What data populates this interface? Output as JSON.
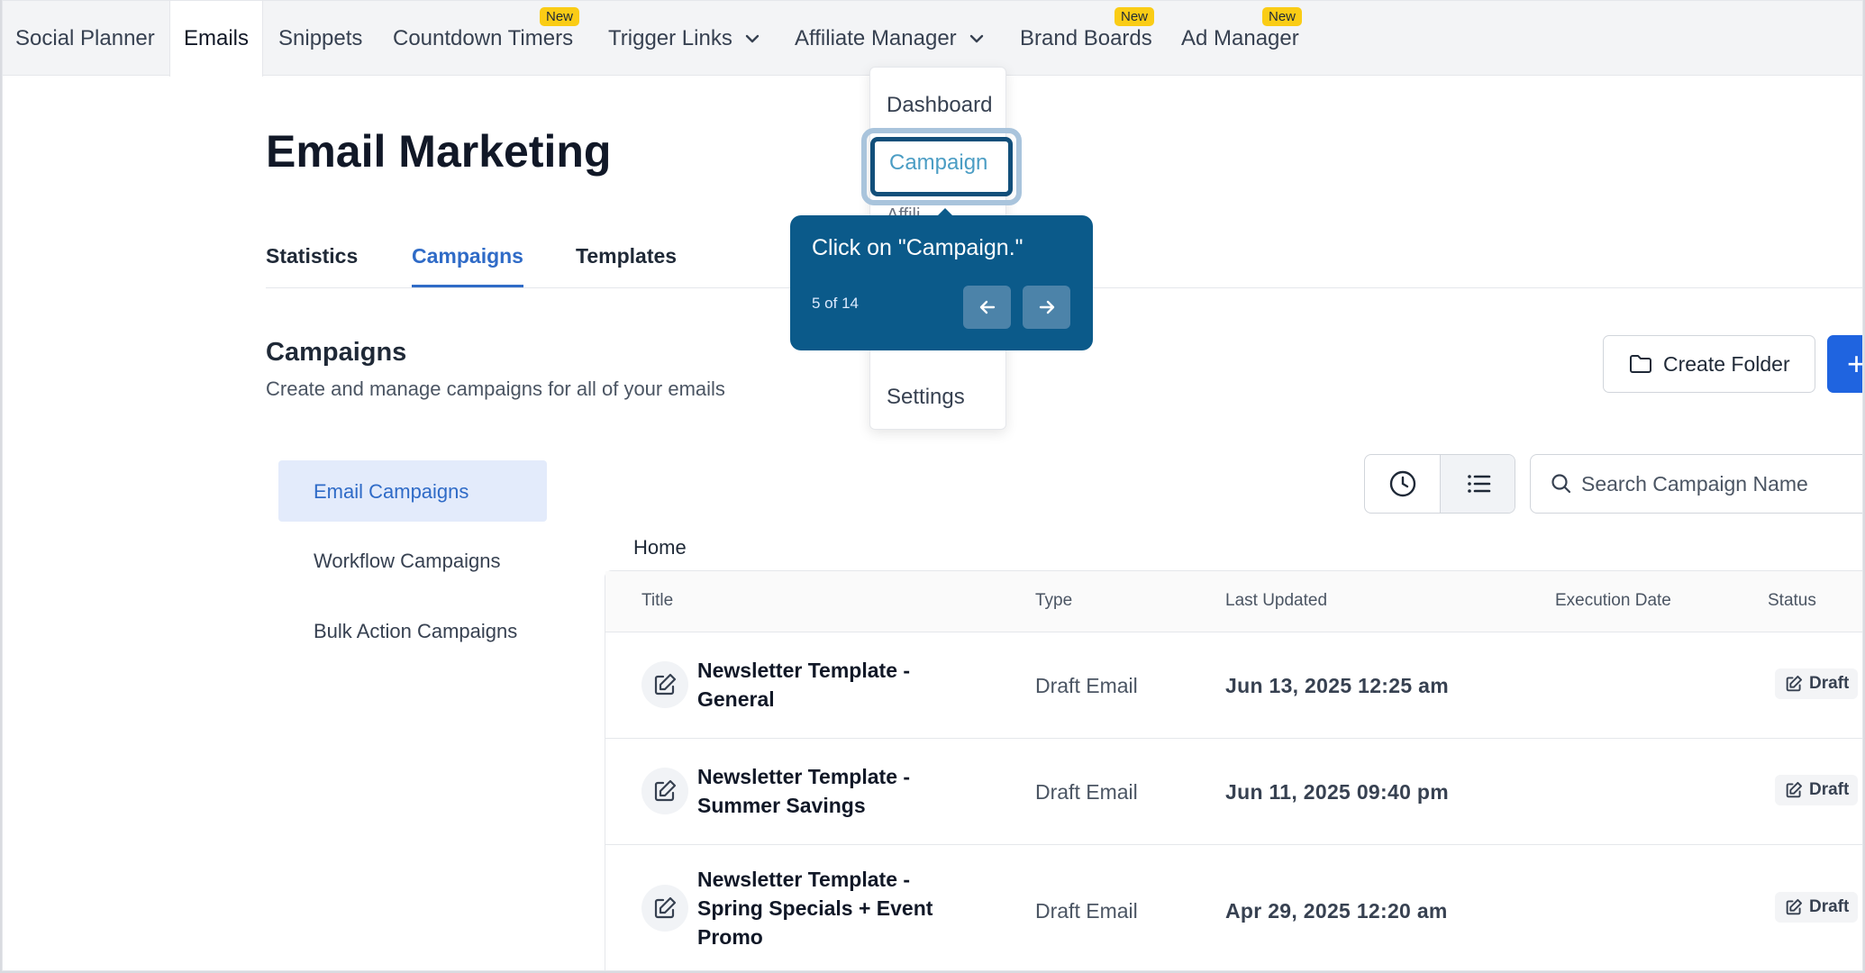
{
  "topnav": {
    "items": [
      {
        "label": "Social Planner"
      },
      {
        "label": "Emails"
      },
      {
        "label": "Snippets"
      },
      {
        "label": "Countdown Timers",
        "badge": "New"
      },
      {
        "label": "Trigger Links"
      },
      {
        "label": "Affiliate Manager"
      },
      {
        "label": "Brand Boards",
        "badge": "New"
      },
      {
        "label": "Ad Manager",
        "badge": "New"
      }
    ]
  },
  "dropdown": {
    "items": [
      "Dashboard",
      "Campaign",
      "Affili",
      "Settings"
    ]
  },
  "tooltip": {
    "text": "Click on \"Campaign.\"",
    "step": "5 of 14"
  },
  "page": {
    "title": "Email Marketing",
    "tabs": [
      "Statistics",
      "Campaigns",
      "Templates"
    ],
    "section_title": "Campaigns",
    "section_subtitle": "Create and manage campaigns for all of your emails",
    "create_folder_label": "Create Folder",
    "new_label": "+"
  },
  "sidebar": {
    "items": [
      "Email Campaigns",
      "Workflow Campaigns",
      "Bulk Action Campaigns"
    ]
  },
  "search": {
    "placeholder": "Search Campaign Name"
  },
  "breadcrumb": "Home",
  "table": {
    "headers": [
      "Title",
      "Type",
      "Last Updated",
      "Execution Date",
      "Status"
    ],
    "rows": [
      {
        "title": "Newsletter Template - General",
        "type": "Draft Email",
        "updated": "Jun 13, 2025 12:25 am",
        "status": "Draft"
      },
      {
        "title": "Newsletter Template - Summer Savings",
        "type": "Draft Email",
        "updated": "Jun 11, 2025 09:40 pm",
        "status": "Draft"
      },
      {
        "title": "Newsletter Template - Spring Specials + Event Promo",
        "type": "Draft Email",
        "updated": "Apr 29, 2025 12:20 am",
        "status": "Draft"
      }
    ]
  },
  "colors": {
    "accent": "#2f6bc7",
    "tooltip_bg": "#0b5a8a",
    "badge": "#facc15",
    "primary_button": "#1f64e0"
  }
}
